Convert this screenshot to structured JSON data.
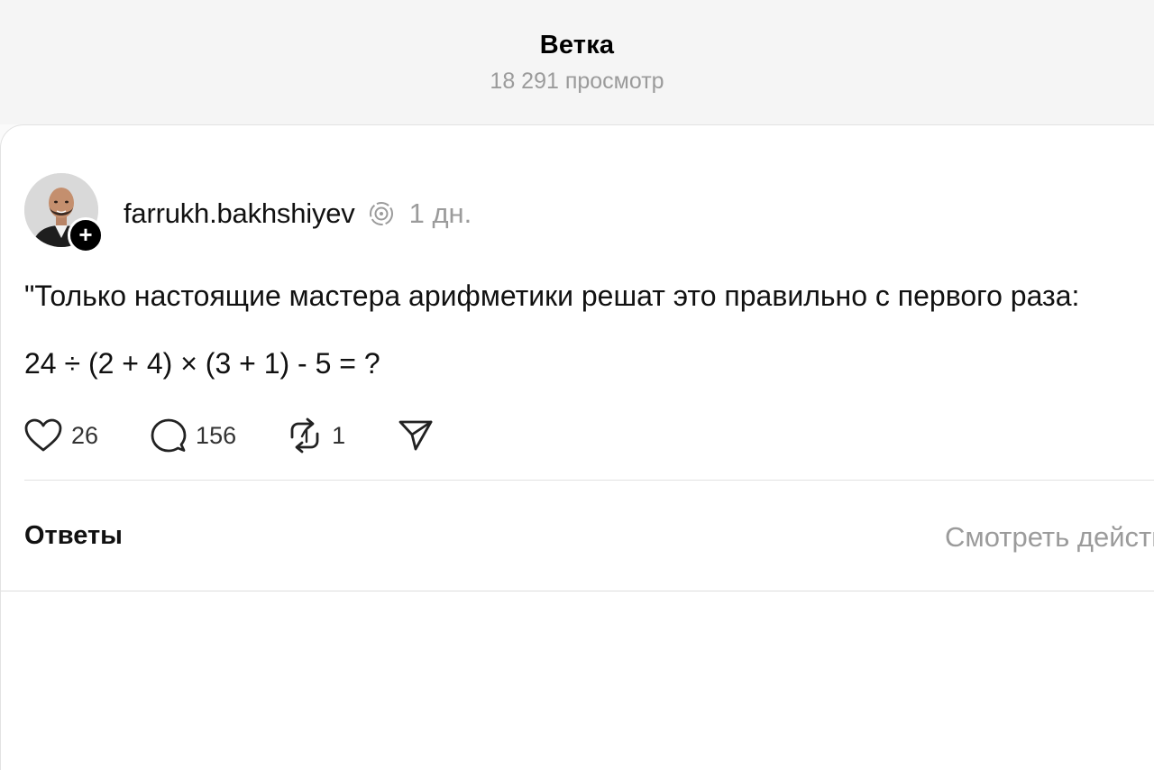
{
  "header": {
    "title": "Ветка",
    "views": "18 291 просмотр"
  },
  "post": {
    "author": {
      "username": "farrukh.bakhshiyev",
      "avatar_icon": "person-photo",
      "follow_icon": "plus-icon",
      "follow_symbol": "+",
      "badge_icon": "threads-verified-icon"
    },
    "time": "1 дн.",
    "text_line1": "\"Только настоящие мастера арифметики решат это правильно с первого раза:",
    "text_line2": "24 ÷ (2 + 4) × (3 + 1) - 5 = ?",
    "actions": {
      "likes": "26",
      "comments": "156",
      "reposts": "1",
      "like_icon": "heart-icon",
      "comment_icon": "speech-bubble-icon",
      "repost_icon": "repost-icon",
      "share_icon": "paper-plane-icon"
    }
  },
  "replies": {
    "label": "Ответы",
    "view_activity": "Смотреть действия"
  },
  "colors": {
    "text_primary": "#111111",
    "text_secondary": "#9b9b9b",
    "divider": "#e2e2e2",
    "header_bg": "#f5f5f5"
  }
}
